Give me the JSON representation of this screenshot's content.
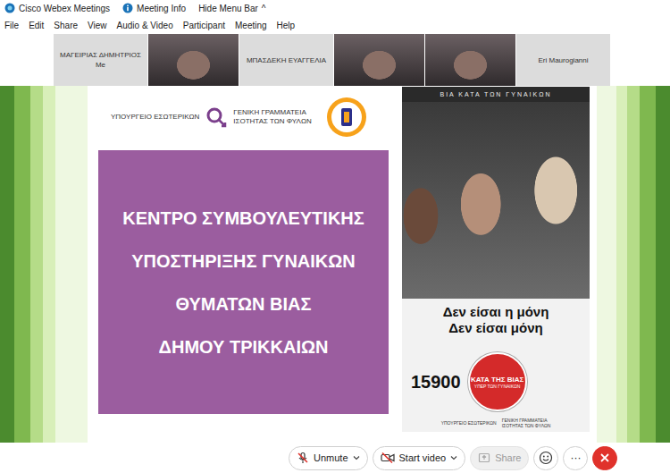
{
  "window": {
    "title": "Cisco Webex Meetings"
  },
  "title_bar": {
    "meeting_info": "Meeting Info",
    "hide_menu": "Hide Menu Bar",
    "caret": "^"
  },
  "menu": [
    "File",
    "Edit",
    "Share",
    "View",
    "Audio & Video",
    "Participant",
    "Meeting",
    "Help"
  ],
  "participants": [
    {
      "kind": "name",
      "name": "ΜΑΓΕΙΡΙΑΣ ΔΗΜΗΤΡΙΟΣ",
      "sub": "Me"
    },
    {
      "kind": "video",
      "name": "",
      "sub": ""
    },
    {
      "kind": "name",
      "name": "ΜΠΑΣΔΕΚΗ ΕΥΑΓΓΕΛΙΑ",
      "sub": ""
    },
    {
      "kind": "video",
      "name": "",
      "sub": ""
    },
    {
      "kind": "video",
      "name": "",
      "sub": ""
    },
    {
      "kind": "name",
      "name": "Eri Maurogianni",
      "sub": ""
    }
  ],
  "slide": {
    "header_left": "ΥΠΟΥΡΓΕΙΟ ΕΣΩΤΕΡΙΚΩΝ",
    "header_right": [
      "ΓΕΝΙΚΗ ΓΡΑΜΜΑΤΕΙΑ",
      "ΙΣΟΤΗΤΑΣ ΤΩΝ ΦΥΛΩΝ"
    ],
    "title_lines": [
      "ΚΕΝΤΡΟ ΣΥΜΒΟΥΛΕΥΤΙΚΗΣ",
      "ΥΠΟΣΤΗΡΙΞΗΣ ΓΥΝΑΙΚΩΝ",
      "ΘΥΜΑΤΩΝ ΒΙΑΣ",
      "ΔΗΜΟΥ ΤΡΙΚΚΑΙΩΝ"
    ],
    "poster": {
      "heading": "ΒΙΑ ΚΑΤΑ ΤΩΝ ΓΥΝΑΙΚΩΝ",
      "slogans": [
        "Δεν είσαι η μόνη",
        "Δεν είσαι μόνη"
      ],
      "phone": "15900",
      "badge": [
        "ΚΑΤΑ ΤΗΣ ΒΙΑΣ",
        "ΥΠΕΡ ΤΩΝ ΓΥΝΑΙΚΩΝ"
      ],
      "footer_left": "ΥΠΟΥΡΓΕΙΟ ΕΣΩΤΕΡΙΚΩΝ",
      "footer_right": [
        "ΓΕΝΙΚΗ ΓΡΑΜΜΑΤΕΙΑ",
        "ΙΣΟΤΗΤΑΣ ΤΩΝ ΦΥΛΩΝ"
      ]
    }
  },
  "controls": [
    {
      "kind": "mic",
      "label": "Unmute",
      "disabled": false,
      "dropdown": true
    },
    {
      "kind": "video",
      "label": "Start video",
      "disabled": false,
      "dropdown": true
    },
    {
      "kind": "share",
      "label": "Share",
      "disabled": true,
      "dropdown": false
    }
  ],
  "more": "···"
}
